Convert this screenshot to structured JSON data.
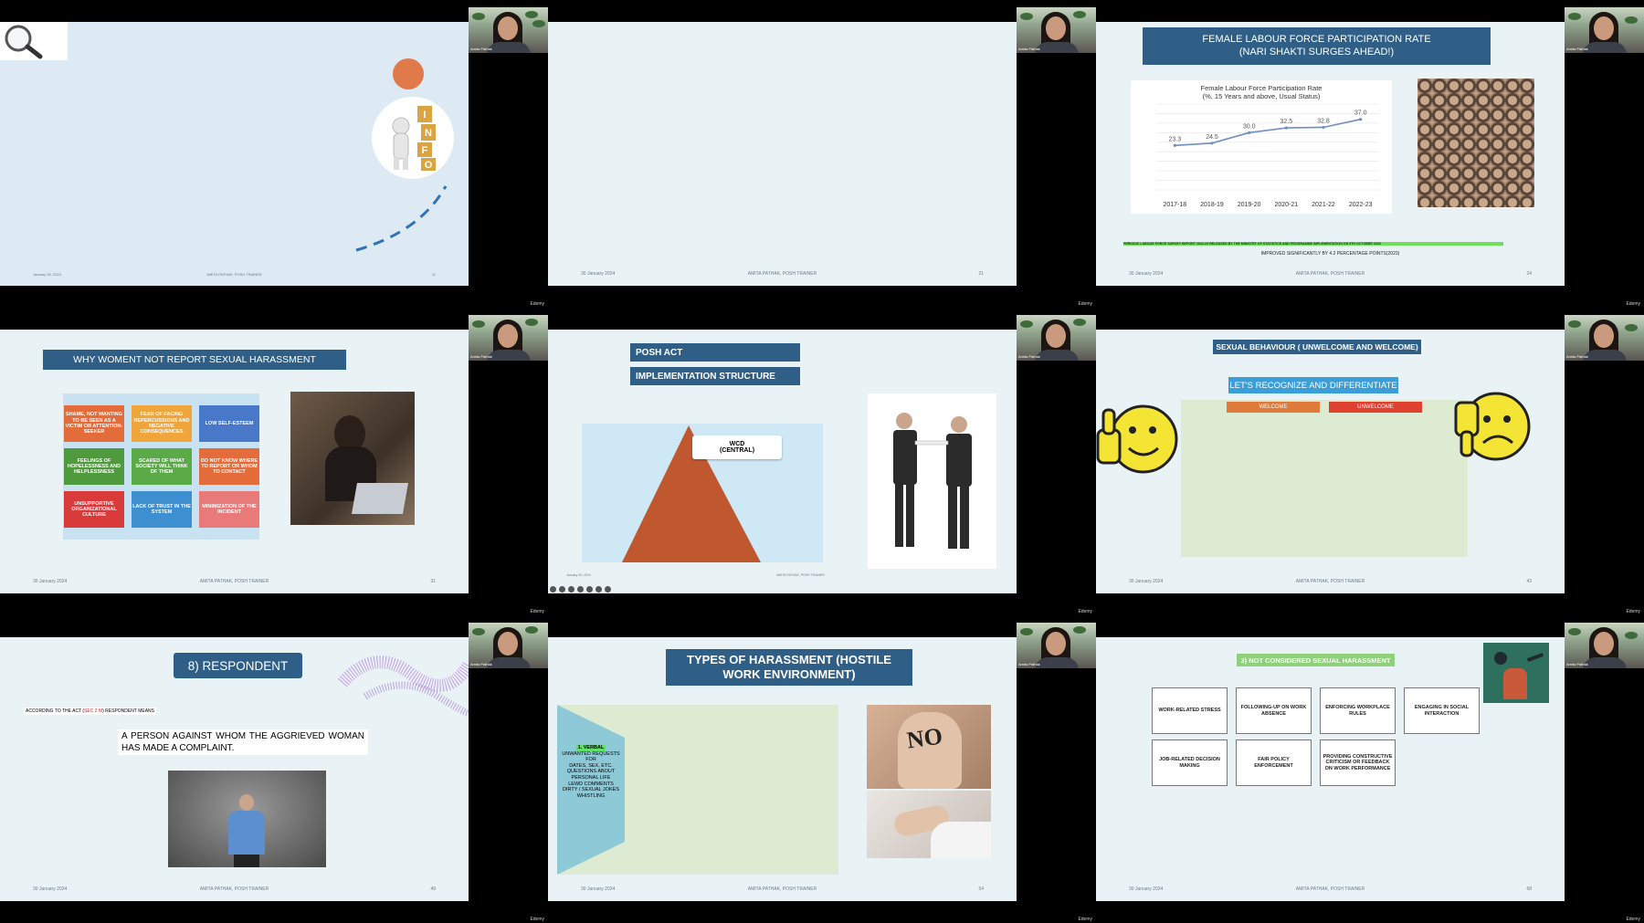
{
  "brand": "Edemy",
  "presenter_tag": "Amita Pathak",
  "footer": {
    "name": "AMITA PATHAK, POSH TRAINER",
    "date": "30 January 2024",
    "date_short": "January 30, 2024"
  },
  "slides": {
    "s1": {
      "num": "11"
    },
    "s2": {
      "num": "21"
    },
    "s3": {
      "title_line1": "FEMALE LABOUR FORCE PARTICIPATION RATE",
      "title_line2": "(NARI SHAKTI SURGES AHEAD!)",
      "note_highlight": "PERIODIC LABOUR FORCE SURVEY REPORT 2022-23 RELEASED BY THE MINISTRY OF STATISTICS AND PROGRAMME IMPLEMENTATION ON 9TH OCTOBER 2023",
      "note": "IMPROVED SIGNIFICANTLY BY 4.2 PERCENTAGE POINTS(2023)",
      "num": "24"
    },
    "s4": {
      "title": "WHY WOMENT NOT REPORT SEXUAL HARASSMENT",
      "boxes": [
        {
          "text": "SHAME, NOT WANTING TO BE SEEN AS A VICTIM OR ATTENTION-SEEKER",
          "color": "#e46c3a"
        },
        {
          "text": "FEAR OF FACING REPERCUSSIONS AND NEGATIVE CONSEQUENCES",
          "color": "#f0a53a"
        },
        {
          "text": "LOW SELF-ESTEEM",
          "color": "#4a78c8"
        },
        {
          "text": "FEELINGS OF HOPELESSNESS AND HELPLESSNESS",
          "color": "#4e9a3c"
        },
        {
          "text": "SCARED OF WHAT SOCIETY WILL THINK OF THEM",
          "color": "#5aaa48"
        },
        {
          "text": "DO NOT KNOW WHERE TO REPORT OR WHOM TO CONTACT",
          "color": "#e46c3a"
        },
        {
          "text": "UNSUPPORTIVE ORGANIZATIONAL CULTURE",
          "color": "#d93a3a"
        },
        {
          "text": "LACK OF TRUST IN THE SYSTEM",
          "color": "#3d8fd0"
        },
        {
          "text": "MINIMIZATION OF THE INCIDENT",
          "color": "#e87a7a"
        }
      ],
      "num": "31"
    },
    "s5": {
      "title1": "POSH ACT",
      "title2": "IMPLEMENTATION STRUCTURE",
      "wcd": "WCD (CENTRAL)"
    },
    "s6": {
      "title": "SEXUAL BEHAVIOUR ( UNWELCOME AND WELCOME)",
      "sub": "LET'S RECOGNIZE AND DIFFERENTIATE",
      "welcome": "WELCOME",
      "unwelcome": "UNWELCOME",
      "num": "43"
    },
    "s7": {
      "title": "8) RESPONDENT",
      "act_pre": "ACCORDING TO THE ACT (",
      "act_red": "SEC 2 M",
      "act_post": ") RESPONDENT MEANS",
      "def": "A PERSON AGAINST WHOM THE AGGRIEVED WOMAN HAS MADE A COMPLAINT.",
      "num": "49"
    },
    "s8": {
      "title": "TYPES OF HARASSMENT (HOSTILE WORK ENVIRONMENT)",
      "verbal": "1. VERBAL",
      "items": [
        "UNWANTED REQUESTS FOR",
        "DATES, SEX, ETC.",
        "QUESTIONS ABOUT PERSONAL LIFE",
        "LEWD COMMENTS",
        "DIRTY / SEXUAL JOKES",
        "WHISTLING"
      ],
      "no_text": "NO",
      "num": "54"
    },
    "s9": {
      "title": "3) NOT CONSIDERED SEXUAL HARASSMENT",
      "boxes": [
        "WORK-RELATED STRESS",
        "FOLLOWING-UP ON WORK ABSENCE",
        "ENFORCING WORKPLACE RULES",
        "ENGAGING IN SOCIAL INTERACTION",
        "JOB-RELATED DECISION MAKING",
        "FAIR POLICY ENFORCEMENT",
        "PROVIDING CONSTRUCTIVE CRITICISM OR FEEDBACK ON WORK PERFORMANCE"
      ],
      "num": "68"
    }
  },
  "chart_data": {
    "type": "line",
    "title": "Female Labour Force Participation Rate",
    "subtitle": "(%, 15 Years and above, Usual Status)",
    "categories": [
      "2017-18",
      "2018-19",
      "2019-20",
      "2020-21",
      "2021-22",
      "2022-23"
    ],
    "values": [
      23.3,
      24.5,
      30.0,
      32.5,
      32.8,
      37.0
    ],
    "labels": [
      "23.3",
      "24.5",
      "30.0",
      "32.5",
      "32.8",
      "37.0"
    ],
    "ylim": [
      0,
      45
    ],
    "grid": true
  }
}
